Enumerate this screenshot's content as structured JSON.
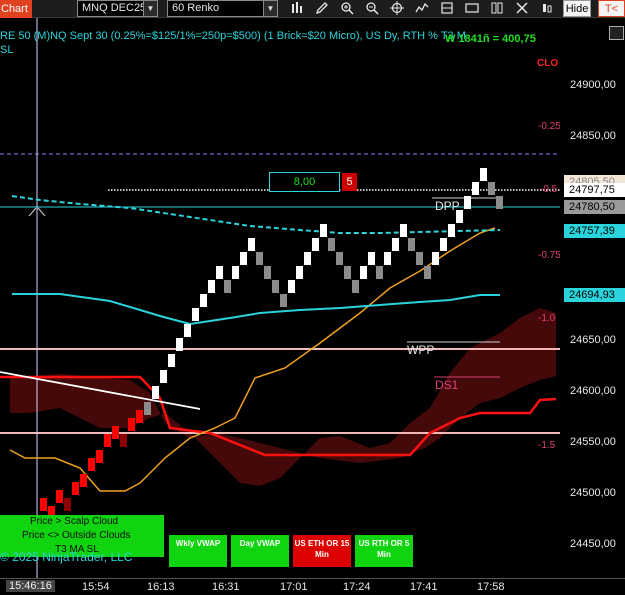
{
  "toolbar": {
    "chart_tab": "Chart",
    "instrument": "MNQ DEC25",
    "bar_type": "60 Renko",
    "hide_button": "Hide",
    "partial_button": "T<"
  },
  "header": {
    "info_line_1": "RE 50 (M)NQ Sept 30 (0.25%=$125/1%=250p=$500)  (1 Brick=$20 Micro), US Dy, RTH %  T3 M",
    "info_line_2": "SL",
    "overlay_text": "W 1841ñ = 400,75",
    "clo_label": "CLO"
  },
  "chart": {
    "order_quantity": "8,00",
    "order_count": "5",
    "level_labels": {
      "dpp": "DPP",
      "wpp": "WPP",
      "ds1": "DS1"
    },
    "percent_labels": [
      "-0.25",
      "-0.5",
      "-0.75",
      "-1.0",
      "-1.5"
    ],
    "copyright": "© 2025 NinjaTrader, LLC",
    "cloud_panel": {
      "line1": "Price > Scalp Cloud",
      "line2": "Price <> Outside Clouds",
      "line3": "T3 MA SL"
    },
    "buttons": {
      "wkly_vwap": "Wkly VWAP",
      "day_vwap": "Day VWAP",
      "us_eth_or": "US ETH OR 15 Min",
      "us_rth_or": "US RTH OR 5 Min"
    }
  },
  "price_axis": {
    "ticks": [
      "24900,00",
      "24850,00",
      "24650,00",
      "24600,00",
      "24550,00",
      "24500,00",
      "24450,00"
    ],
    "flags": {
      "price_a": "24805,50",
      "price_b": "24797,75",
      "price_c": "24780,50",
      "price_d": "24757,39",
      "price_e": "24694,93"
    }
  },
  "time_axis": {
    "cursor_time": "15:46:16",
    "labels": [
      "15:54",
      "16:13",
      "16:31",
      "17:01",
      "17:24",
      "17:41",
      "17:58"
    ]
  },
  "colors": {
    "bull_brick": "#ffffff",
    "bear_brick": "#8c8c8c",
    "bull_brick_old": "#ff0000",
    "bear_brick_old": "#8b0000",
    "cyan": "#2ad4dc",
    "orange": "#f0a020",
    "red_line": "#ff1010",
    "pink_line": "#f2b9b9",
    "cloud": "#5a0c0c",
    "green_btn": "#11d411",
    "red_btn": "#dd0000"
  }
}
